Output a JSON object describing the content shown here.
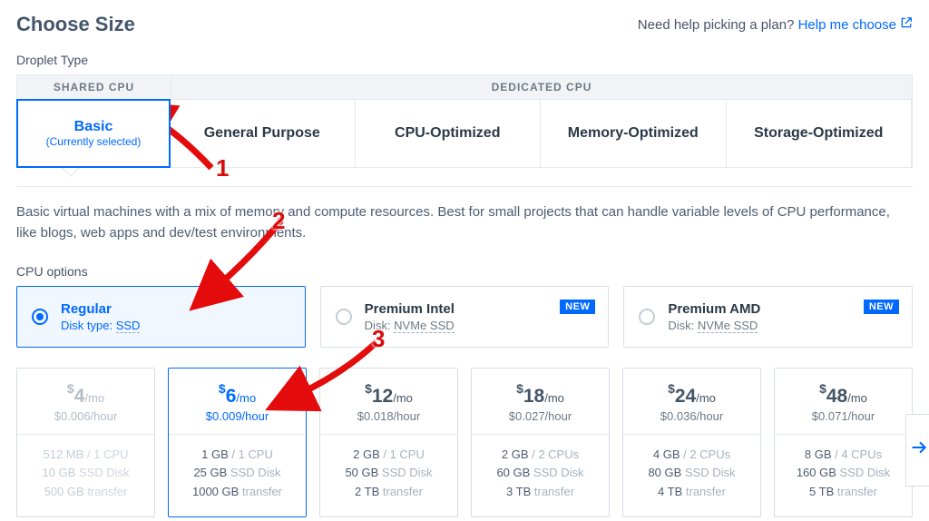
{
  "header": {
    "title": "Choose Size",
    "help_prefix": "Need help picking a plan? ",
    "help_link": "Help me choose"
  },
  "droplet_type": {
    "label": "Droplet Type",
    "shared_header": "SHARED CPU",
    "dedicated_header": "DEDICATED CPU",
    "tabs": [
      {
        "main": "Basic",
        "sub": "(Currently selected)"
      },
      {
        "main": "General Purpose"
      },
      {
        "main": "CPU-Optimized"
      },
      {
        "main": "Memory-Optimized"
      },
      {
        "main": "Storage-Optimized"
      }
    ]
  },
  "description": "Basic virtual machines with a mix of memory and compute resources. Best for small projects that can handle variable levels of CPU performance, like blogs, web apps and dev/test environments.",
  "cpu_options": {
    "label": "CPU options",
    "cards": [
      {
        "title": "Regular",
        "sub_prefix": "Disk type: ",
        "sub_disk": "SSD",
        "new": false
      },
      {
        "title": "Premium Intel",
        "sub_prefix": "Disk: ",
        "sub_disk": "NVMe SSD",
        "new": true,
        "new_label": "NEW"
      },
      {
        "title": "Premium AMD",
        "sub_prefix": "Disk: ",
        "sub_disk": "NVMe SSD",
        "new": true,
        "new_label": "NEW"
      }
    ]
  },
  "plans": [
    {
      "price": "4",
      "hour": "$0.006/hour",
      "mem": "512 MB",
      "cpu": "1 CPU",
      "disk": "10 GB",
      "disk_suffix": "SSD Disk",
      "xfer": "500 GB",
      "xfer_suffix": "transfer"
    },
    {
      "price": "6",
      "hour": "$0.009/hour",
      "mem": "1 GB",
      "cpu": "1 CPU",
      "disk": "25 GB",
      "disk_suffix": "SSD Disk",
      "xfer": "1000 GB",
      "xfer_suffix": "transfer"
    },
    {
      "price": "12",
      "hour": "$0.018/hour",
      "mem": "2 GB",
      "cpu": "1 CPU",
      "disk": "50 GB",
      "disk_suffix": "SSD Disk",
      "xfer": "2 TB",
      "xfer_suffix": "transfer"
    },
    {
      "price": "18",
      "hour": "$0.027/hour",
      "mem": "2 GB",
      "cpu": "2 CPUs",
      "disk": "60 GB",
      "disk_suffix": "SSD Disk",
      "xfer": "3 TB",
      "xfer_suffix": "transfer"
    },
    {
      "price": "24",
      "hour": "$0.036/hour",
      "mem": "4 GB",
      "cpu": "2 CPUs",
      "disk": "80 GB",
      "disk_suffix": "SSD Disk",
      "xfer": "4 TB",
      "xfer_suffix": "transfer"
    },
    {
      "price": "48",
      "hour": "$0.071/hour",
      "mem": "8 GB",
      "cpu": "4 CPUs",
      "disk": "160 GB",
      "disk_suffix": "SSD Disk",
      "xfer": "5 TB",
      "xfer_suffix": "transfer"
    }
  ],
  "common": {
    "per_month": "/mo",
    "dollar": "$",
    "slash": " / "
  },
  "annotations": {
    "n1": "1",
    "n2": "2",
    "n3": "3"
  }
}
